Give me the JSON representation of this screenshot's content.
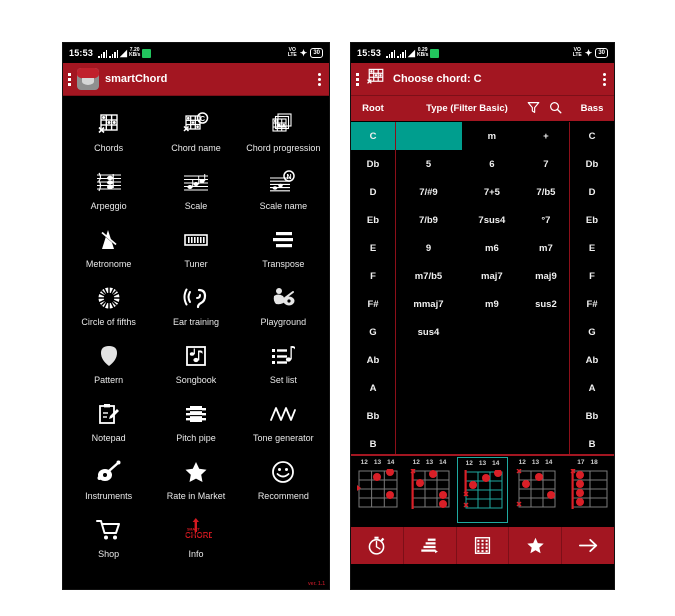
{
  "colors": {
    "brand_red": "#a31621",
    "accent_teal": "#009e8e",
    "selected_border": "#1fa9a0",
    "background": "#000000",
    "dot_red": "#d91f27",
    "battery_green": "#22c55e"
  },
  "left_phone": {
    "statusbar": {
      "time": "15:53",
      "volte_label_top": "VO",
      "volte_label_bottom": "LTE",
      "battery_level": "30",
      "icons": [
        "signal-bars-icon",
        "signal-bars-icon",
        "wifi-icon",
        "data-icon",
        "green-indicator-icon",
        "volte-icon",
        "bluetooth-icon",
        "battery-icon"
      ]
    },
    "appbar": {
      "menu_icon": "hamburger-menu-icon",
      "logo_icon": "smartchord-app-logo",
      "title": "smartChord",
      "overflow_icon": "overflow-menu-icon"
    },
    "grid_items": [
      {
        "label": "Chords",
        "icon": "chord-grid-icon"
      },
      {
        "label": "Chord name",
        "icon": "chord-name-icon"
      },
      {
        "label": "Chord progression",
        "icon": "chord-progression-icon"
      },
      {
        "label": "Arpeggio",
        "icon": "arpeggio-staff-icon"
      },
      {
        "label": "Scale",
        "icon": "scale-staff-icon"
      },
      {
        "label": "Scale name",
        "icon": "scale-name-icon"
      },
      {
        "label": "Metronome",
        "icon": "metronome-icon"
      },
      {
        "label": "Tuner",
        "icon": "tuner-icon"
      },
      {
        "label": "Transpose",
        "icon": "transpose-icon"
      },
      {
        "label": "Circle of fifths",
        "icon": "circle-of-fifths-icon"
      },
      {
        "label": "Ear training",
        "icon": "ear-training-icon"
      },
      {
        "label": "Playground",
        "icon": "playground-guitarist-icon"
      },
      {
        "label": "Pattern",
        "icon": "pick-pattern-icon"
      },
      {
        "label": "Songbook",
        "icon": "songbook-icon"
      },
      {
        "label": "Set list",
        "icon": "set-list-icon"
      },
      {
        "label": "Notepad",
        "icon": "notepad-icon"
      },
      {
        "label": "Pitch pipe",
        "icon": "pitch-pipe-icon"
      },
      {
        "label": "Tone generator",
        "icon": "tone-generator-wave-icon"
      },
      {
        "label": "Instruments",
        "icon": "guitar-instrument-icon"
      },
      {
        "label": "Rate in Market",
        "icon": "star-icon"
      },
      {
        "label": "Recommend",
        "icon": "smiley-face-icon"
      },
      {
        "label": "Shop",
        "icon": "shopping-cart-icon"
      },
      {
        "label": "Info",
        "icon": "smartchord-wordmark-icon"
      }
    ],
    "version_text": "ver. 1.1"
  },
  "right_phone": {
    "statusbar": {
      "time": "15:53",
      "volte_label_top": "VO",
      "volte_label_bottom": "LTE",
      "battery_level": "30"
    },
    "appbar": {
      "menu_icon": "hamburger-menu-icon",
      "logo_icon": "chord-grid-icon",
      "title": "Choose chord: C",
      "overflow_icon": "overflow-menu-icon"
    },
    "column_header": {
      "root_label": "Root",
      "type_label": "Type (Filter Basic)",
      "filter_icon": "filter-funnel-icon",
      "search_icon": "search-magnifier-icon",
      "bass_label": "Bass"
    },
    "chord_table": {
      "selected_root": "C",
      "selected_type": "",
      "rows": [
        {
          "root": "C",
          "types": [
            "",
            "m",
            "+"
          ],
          "bass": "C"
        },
        {
          "root": "Db",
          "types": [
            "5",
            "6",
            "7"
          ],
          "bass": "Db"
        },
        {
          "root": "D",
          "types": [
            "7/#9",
            "7+5",
            "7/b5"
          ],
          "bass": "D"
        },
        {
          "root": "Eb",
          "types": [
            "7/b9",
            "7sus4",
            "°7"
          ],
          "bass": "Eb"
        },
        {
          "root": "E",
          "types": [
            "9",
            "m6",
            "m7"
          ],
          "bass": "E"
        },
        {
          "root": "F",
          "types": [
            "m7/b5",
            "maj7",
            "maj9"
          ],
          "bass": "F"
        },
        {
          "root": "F#",
          "types": [
            "mmaj7",
            "m9",
            "sus2"
          ],
          "bass": "F#"
        },
        {
          "root": "G",
          "types": [
            "sus4",
            "",
            ""
          ],
          "bass": "G"
        },
        {
          "root": "Ab",
          "types": [
            "",
            "",
            ""
          ],
          "bass": "Ab"
        },
        {
          "root": "A",
          "types": [
            "",
            "",
            ""
          ],
          "bass": "A"
        },
        {
          "root": "Bb",
          "types": [
            "",
            "",
            ""
          ],
          "bass": "Bb"
        },
        {
          "root": "B",
          "types": [
            "",
            "",
            ""
          ],
          "bass": "B"
        }
      ]
    },
    "chord_diagrams": [
      {
        "fret_labels": [
          "12",
          "13",
          "14"
        ],
        "selected": false
      },
      {
        "fret_labels": [
          "12",
          "13",
          "14"
        ],
        "selected": false
      },
      {
        "fret_labels": [
          "12",
          "13",
          "14"
        ],
        "selected": true
      },
      {
        "fret_labels": [
          "12",
          "13",
          "14"
        ],
        "selected": false
      },
      {
        "fret_labels": [
          "17",
          "18"
        ],
        "selected": false
      }
    ],
    "bottom_toolbar": [
      {
        "icon": "metronome-timer-icon"
      },
      {
        "icon": "sort-bars-icon"
      },
      {
        "icon": "grid-fretboard-icon"
      },
      {
        "icon": "star-icon"
      },
      {
        "icon": "arrow-right-icon"
      }
    ]
  }
}
